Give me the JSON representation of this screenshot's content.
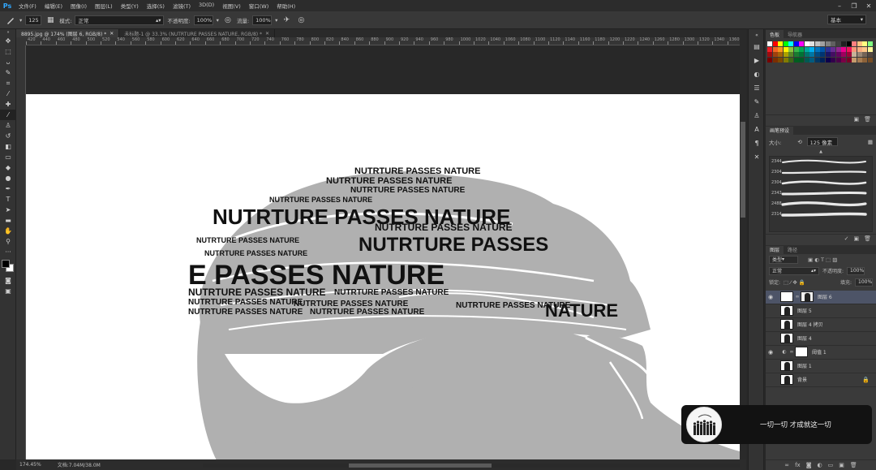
{
  "menubar": {
    "logo": "Ps",
    "items": [
      "文件(F)",
      "编辑(E)",
      "图像(I)",
      "图层(L)",
      "类型(Y)",
      "选择(S)",
      "滤镜(T)",
      "3D(D)",
      "视图(V)",
      "窗口(W)",
      "帮助(H)"
    ]
  },
  "options": {
    "brush_size": "125",
    "mode_label": "模式:",
    "mode_value": "正常",
    "opacity_label": "不透明度:",
    "opacity_value": "100%",
    "flow_label": "流量:",
    "flow_value": "100%",
    "workspace_value": "基本"
  },
  "tabs": [
    {
      "label": "8895.jpg @ 174% (图层 6, RGB/8) *",
      "active": true
    },
    {
      "label": "未标题-1 @ 33.3% (NUTRTURE PASSES NATURE, RGB/8) *",
      "active": false
    }
  ],
  "ruler_ticks": [
    "420",
    "440",
    "460",
    "480",
    "500",
    "520",
    "540",
    "560",
    "580",
    "600",
    "620",
    "640",
    "660",
    "680",
    "700",
    "720",
    "740",
    "760",
    "780",
    "800",
    "820",
    "840",
    "860",
    "880",
    "900",
    "920",
    "940",
    "960",
    "980",
    "1000",
    "1020",
    "1040",
    "1060",
    "1080",
    "1100",
    "1120",
    "1140",
    "1160",
    "1180",
    "1200",
    "1220",
    "1240",
    "1260",
    "1280",
    "1300",
    "1320",
    "1340",
    "1360",
    "1380"
  ],
  "status": {
    "zoom": "174.45%",
    "doc": "文档:7.04M/38.0M"
  },
  "artwork": {
    "lines": [
      {
        "text": "NUTRTURE PASSES NATURE",
        "size": 11
      },
      {
        "text": "NUTRTURE PASSES NATURE",
        "size": 11
      },
      {
        "text": "NUTRTURE PASSES NATURE",
        "size": 10
      },
      {
        "text": "NUTRTURE PASSES NATURE",
        "size": 9
      },
      {
        "text": "NUTRTURE PASSES NATURE",
        "size": 26
      },
      {
        "text": "NUTRTURE PASSES NATURE",
        "size": 12
      },
      {
        "text": "NUTRTURE PASSES",
        "size": 24
      },
      {
        "text": "NUTRTURE PASSES NATURE",
        "size": 9
      },
      {
        "text": "NUTRTURE PASSES NATURE",
        "size": 9
      },
      {
        "text": "E PASSES NATURE",
        "size": 34
      },
      {
        "text": "NUTRTURE PASSES NATURE",
        "size": 12
      },
      {
        "text": "NUTRTURE PASSES NATURE",
        "size": 10
      },
      {
        "text": "NUTRTURE PASSES NATURE",
        "size": 10
      },
      {
        "text": "NUTRTURE PASSES NATURE",
        "size": 10
      },
      {
        "text": "NUTRTURE PASSES NATURE",
        "size": 10
      },
      {
        "text": "NUTRTURE PASSES NATURE",
        "size": 10
      },
      {
        "text": "NUTRTURE PASSES NATURE",
        "size": 10
      },
      {
        "text": "NATURE",
        "size": 22
      }
    ]
  },
  "panels": {
    "swatch_tabs": [
      "色板",
      "导航器"
    ],
    "brush_tab": "画笔预设",
    "brush_size_label": "大小:",
    "brush_size_value": "125 像素",
    "brushes": [
      "2344",
      "2304",
      "2304",
      "2343",
      "2488",
      "2314"
    ],
    "layers_tabs": [
      "图层",
      "路径"
    ],
    "filter_label": "类型",
    "blend_mode": "正常",
    "opacity_label": "不透明度:",
    "opacity_value": "100%",
    "lock_label": "锁定:",
    "fill_label": "填充:",
    "fill_value": "100%",
    "layers": [
      {
        "name": "图层 6",
        "visible": true,
        "selected": true,
        "type": "mask"
      },
      {
        "name": "图层 5",
        "visible": false,
        "selected": false,
        "type": "portrait"
      },
      {
        "name": "图层 4 拷贝",
        "visible": false,
        "selected": false,
        "type": "portrait"
      },
      {
        "name": "图层 4",
        "visible": false,
        "selected": false,
        "type": "portrait"
      },
      {
        "name": "阈值 1",
        "visible": true,
        "selected": false,
        "type": "adjustment"
      },
      {
        "name": "图层 1",
        "visible": false,
        "selected": false,
        "type": "portrait"
      },
      {
        "name": "背景",
        "visible": false,
        "selected": false,
        "type": "background"
      }
    ]
  },
  "toast": {
    "text": "一切一切 才成就这一切"
  },
  "colors": {
    "accent": "#31a8ff",
    "selected_layer": "#4d5467"
  }
}
